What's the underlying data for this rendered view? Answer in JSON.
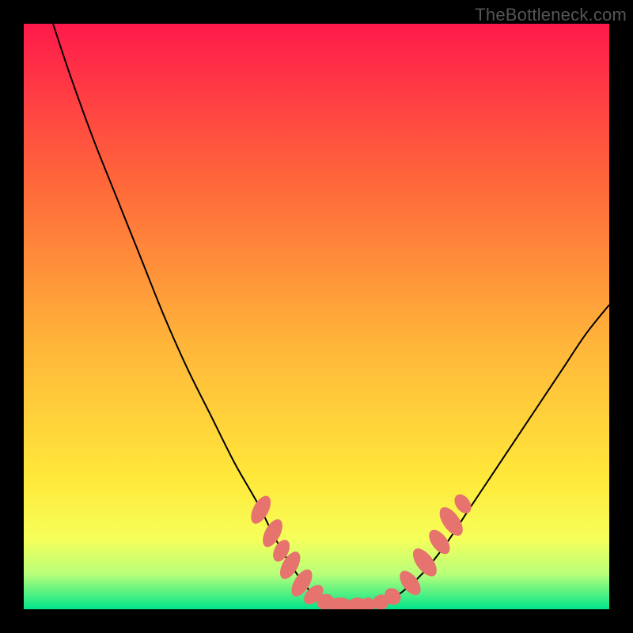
{
  "watermark": "TheBottleneck.com",
  "chart_data": {
    "type": "line",
    "title": "",
    "xlabel": "",
    "ylabel": "",
    "xlim": [
      0,
      100
    ],
    "ylim": [
      0,
      100
    ],
    "grid": false,
    "legend": false,
    "background_gradient_stops": [
      {
        "offset": 0,
        "color": "#ff1a4b"
      },
      {
        "offset": 28,
        "color": "#ff6a3a"
      },
      {
        "offset": 55,
        "color": "#ffb63a"
      },
      {
        "offset": 78,
        "color": "#ffe93a"
      },
      {
        "offset": 88,
        "color": "#f6ff5a"
      },
      {
        "offset": 94,
        "color": "#b8ff7a"
      },
      {
        "offset": 100,
        "color": "#00e58a"
      }
    ],
    "series": [
      {
        "name": "bottleneck-curve",
        "x": [
          5,
          8,
          12,
          16,
          20,
          24,
          28,
          32,
          36,
          40,
          43,
          46,
          49,
          52,
          55,
          58,
          61,
          64,
          68,
          72,
          76,
          80,
          84,
          88,
          92,
          96,
          100
        ],
        "y": [
          100,
          91,
          80,
          70,
          60,
          50,
          41,
          33,
          25,
          18,
          12,
          7,
          3,
          1,
          0.5,
          0.5,
          1,
          2.5,
          6,
          11,
          17,
          23,
          29,
          35,
          41,
          47,
          52
        ]
      }
    ],
    "markers": {
      "name": "highlight-dots",
      "color": "#e6736e",
      "points": [
        {
          "x": 40.5,
          "y": 17,
          "rx": 1.3,
          "ry": 2.6,
          "rot": 28
        },
        {
          "x": 42.5,
          "y": 13,
          "rx": 1.3,
          "ry": 2.6,
          "rot": 28
        },
        {
          "x": 44,
          "y": 10,
          "rx": 1.2,
          "ry": 2.0,
          "rot": 28
        },
        {
          "x": 45.5,
          "y": 7.5,
          "rx": 1.3,
          "ry": 2.6,
          "rot": 30
        },
        {
          "x": 47.5,
          "y": 4.5,
          "rx": 1.3,
          "ry": 2.6,
          "rot": 32
        },
        {
          "x": 49.5,
          "y": 2.5,
          "rx": 1.2,
          "ry": 2.0,
          "rot": 45
        },
        {
          "x": 51.5,
          "y": 1.3,
          "rx": 1.3,
          "ry": 1.5,
          "rot": 70
        },
        {
          "x": 54,
          "y": 0.7,
          "rx": 2.2,
          "ry": 1.3,
          "rot": 0
        },
        {
          "x": 57,
          "y": 0.7,
          "rx": 1.6,
          "ry": 1.3,
          "rot": 0
        },
        {
          "x": 58.8,
          "y": 0.7,
          "rx": 1.2,
          "ry": 1.3,
          "rot": 0
        },
        {
          "x": 61,
          "y": 1.2,
          "rx": 1.4,
          "ry": 1.3,
          "rot": -20
        },
        {
          "x": 63,
          "y": 2.2,
          "rx": 1.3,
          "ry": 1.5,
          "rot": -40
        },
        {
          "x": 66,
          "y": 4.5,
          "rx": 1.3,
          "ry": 2.4,
          "rot": -37
        },
        {
          "x": 68.5,
          "y": 8,
          "rx": 1.4,
          "ry": 2.8,
          "rot": -37
        },
        {
          "x": 71,
          "y": 11.5,
          "rx": 1.3,
          "ry": 2.4,
          "rot": -37
        },
        {
          "x": 73,
          "y": 15,
          "rx": 1.4,
          "ry": 2.8,
          "rot": -35
        },
        {
          "x": 75,
          "y": 18,
          "rx": 1.2,
          "ry": 1.8,
          "rot": -35
        }
      ]
    }
  }
}
